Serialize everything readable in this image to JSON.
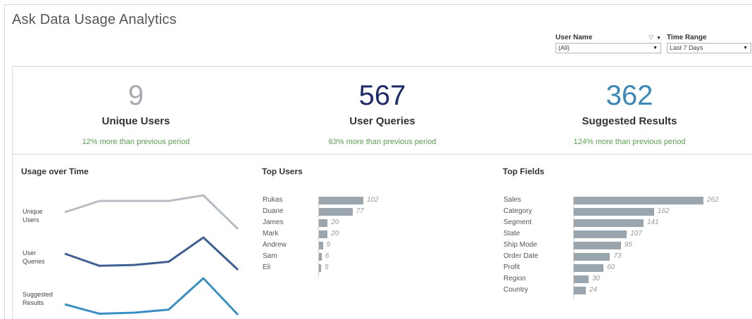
{
  "title": "Ask Data Usage Analytics",
  "filters": {
    "user_name": {
      "label": "User Name",
      "value": "(All)"
    },
    "time_range": {
      "label": "Time Range",
      "value": "Last 7 Days"
    }
  },
  "kpis": [
    {
      "value": "9",
      "label": "Unique Users",
      "change": "12% more than previous period",
      "color": "#a6aab0"
    },
    {
      "value": "567",
      "label": "User Queries",
      "change": "63% more than previous period",
      "color": "#1f2a6b"
    },
    {
      "value": "362",
      "label": "Suggested Results",
      "change": "124% more than previous period",
      "color": "#3a87b8"
    }
  ],
  "sections": {
    "usage_over_time": "Usage over Time",
    "top_users": "Top Users",
    "top_fields": "Top Fields"
  },
  "chart_data": [
    {
      "type": "line",
      "title": "Usage over Time",
      "series": [
        {
          "name": "Unique Users",
          "values": [
            6,
            8,
            8,
            8,
            9,
            3
          ],
          "color": "#b8bcc3"
        },
        {
          "name": "User Queries",
          "values": [
            80,
            50,
            52,
            60,
            120,
            40
          ],
          "color": "#3f5f93"
        },
        {
          "name": "Suggested Results",
          "values": [
            40,
            22,
            24,
            30,
            90,
            20
          ],
          "color": "#3a8fc2"
        }
      ]
    },
    {
      "type": "bar",
      "title": "Top Users",
      "categories": [
        "Rukas",
        "Duane",
        "James",
        "Mark",
        "Andrew",
        "Sam",
        "Eli"
      ],
      "values": [
        102,
        77,
        20,
        20,
        9,
        6,
        5
      ]
    },
    {
      "type": "bar",
      "title": "Top Fields",
      "categories": [
        "Sales",
        "Category",
        "Segment",
        "State",
        "Ship Mode",
        "Order Date",
        "Profit",
        "Region",
        "Country"
      ],
      "values": [
        262,
        162,
        141,
        107,
        95,
        73,
        60,
        30,
        24
      ]
    }
  ]
}
